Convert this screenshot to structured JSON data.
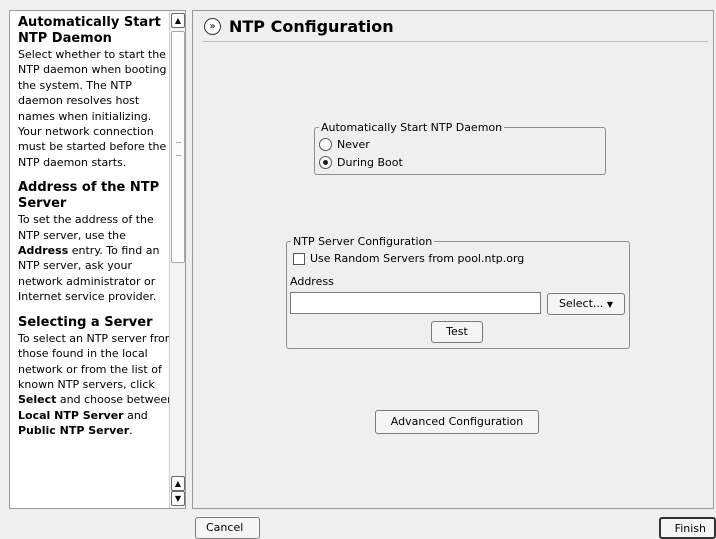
{
  "help": {
    "sections": [
      {
        "heading": "Automatically Start NTP Daemon",
        "text": "Select whether to start the NTP daemon when booting the system. The NTP daemon resolves host names when initializing. Your network connection must be started before the NTP daemon starts."
      },
      {
        "heading": "Address of the NTP Server",
        "text_pre": "To set the address of the NTP server, use the ",
        "text_bold": "Address",
        "text_post": " entry. To find an NTP server, ask your network administrator or Internet service provider."
      },
      {
        "heading": "Selecting a Server",
        "text_pre": "To select an NTP server from those found in the local network or from the list of known NTP servers, click ",
        "bold1": "Select",
        "mid": " and choose between ",
        "bold2": "Local NTP Server",
        "mid2": " and ",
        "bold3": "Public NTP Server",
        "end": "."
      }
    ],
    "scroll_up": "▲",
    "scroll_down": "▼"
  },
  "header": {
    "icon": "»",
    "title": "NTP Configuration"
  },
  "daemon_group": {
    "legend": "Automatically Start NTP Daemon",
    "options": [
      {
        "label": "Never",
        "selected": false
      },
      {
        "label": "During Boot",
        "selected": true
      }
    ]
  },
  "server_group": {
    "legend": "NTP Server Configuration",
    "random_label": "Use Random Servers from pool.ntp.org",
    "random_checked": false,
    "address_label": "Address",
    "address_value": "",
    "select_label": "Select...",
    "select_arrow": "▼",
    "test_label": "Test"
  },
  "advanced_label": "Advanced Configuration",
  "footer": {
    "cancel_label": "Cancel",
    "finish_label": "Finish"
  }
}
